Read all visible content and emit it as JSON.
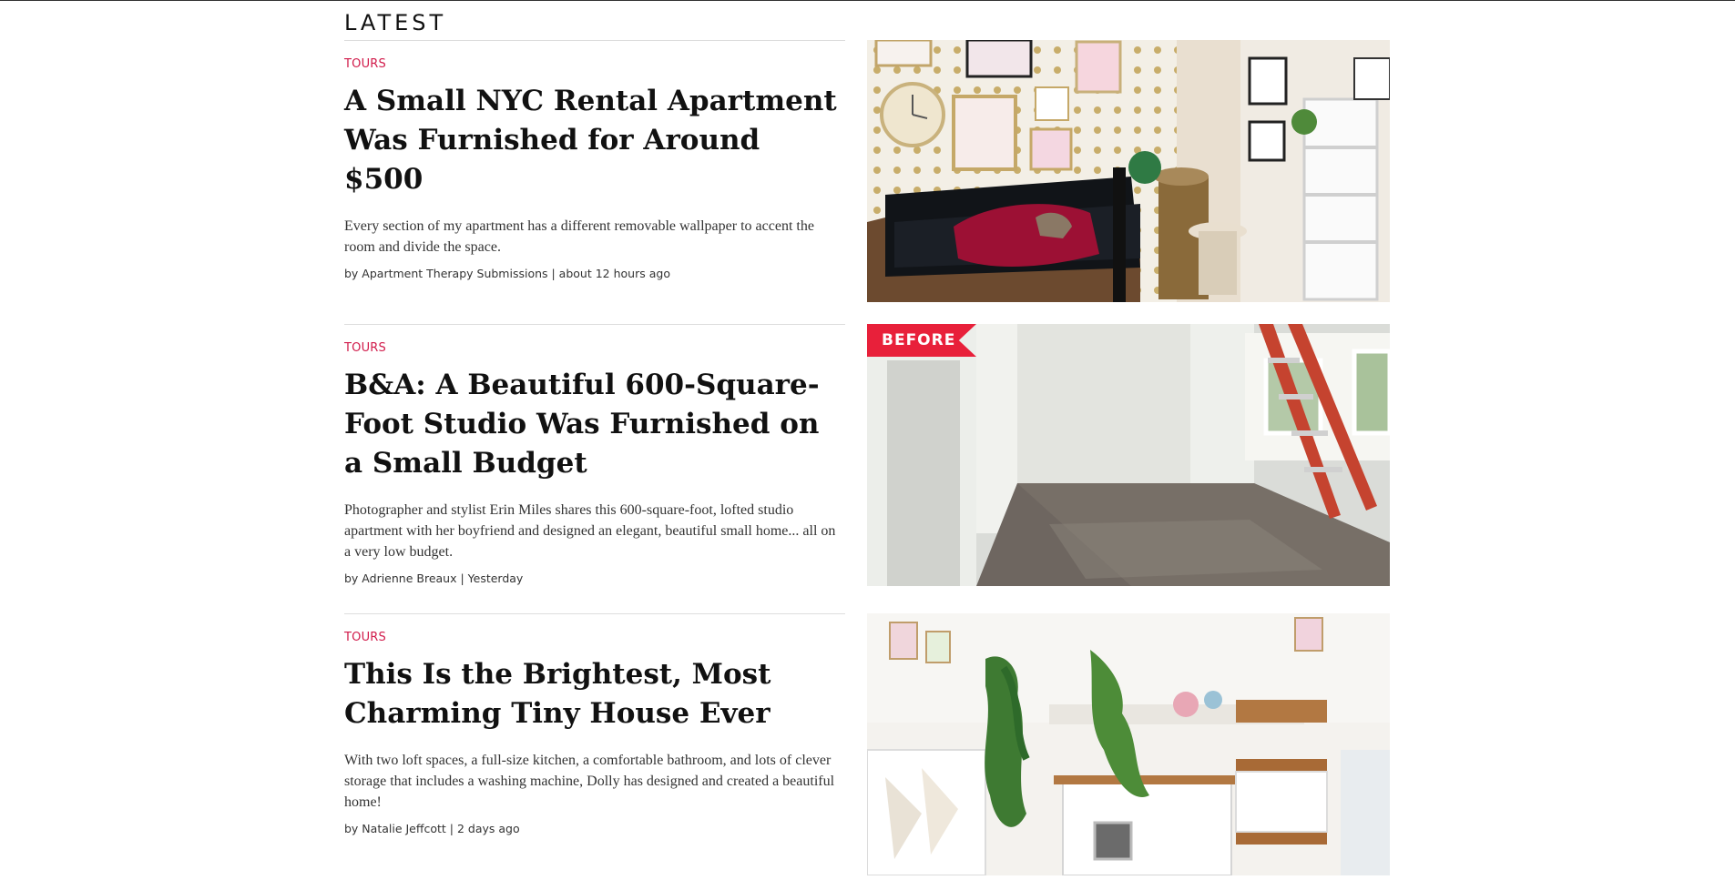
{
  "section": {
    "title": "LATEST"
  },
  "articles": [
    {
      "category": "TOURS",
      "title": "A Small NYC Rental Apartment Was Furnished for Around $500",
      "summary": "Every section of my apartment has a different removable wallpaper to accent the room and divide the space.",
      "byline": "by Apartment Therapy Submissions | about 12 hours ago",
      "image": {
        "subject": "living-room-with-polka-dot-wallpaper-and-black-sofa"
      }
    },
    {
      "category": "TOURS",
      "title": "B&A: A Beautiful 600-Square-Foot Studio Was Furnished on a Small Budget",
      "summary": "Photographer and stylist Erin Miles shares this 600-square-foot, lofted studio apartment with her boyfriend and designed an elegant, beautiful small home... all on a very low budget.",
      "byline": "by Adrienne Breaux | Yesterday",
      "image": {
        "subject": "empty-studio-with-red-ladder",
        "badge": "BEFORE"
      }
    },
    {
      "category": "TOURS",
      "title": "This Is the Brightest, Most Charming Tiny House Ever",
      "summary": "With two loft spaces, a full-size kitchen, a comfortable bathroom, and lots of clever storage that includes a washing machine, Dolly has designed and created a beautiful home!",
      "byline": "by Natalie Jeffcott | 2 days ago",
      "image": {
        "subject": "bright-tiny-house-interior-with-plants"
      }
    }
  ],
  "colors": {
    "accent": "#d11a4a",
    "badge": "#e8203a"
  }
}
